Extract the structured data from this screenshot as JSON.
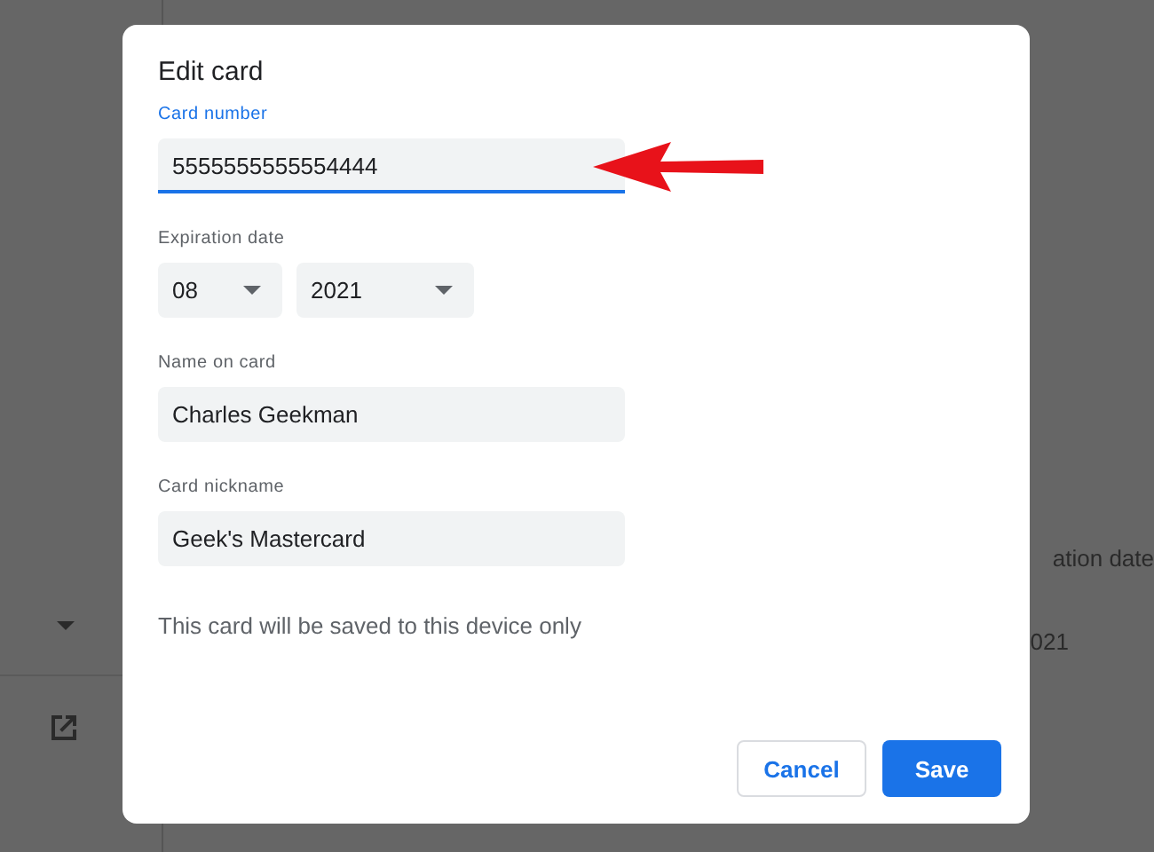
{
  "background": {
    "texts": [
      "ation date",
      "021"
    ]
  },
  "dialog": {
    "title": "Edit card",
    "fields": [
      {
        "kind": "text",
        "label": "Card number",
        "value": "5555555555554444",
        "focused": true
      },
      {
        "kind": "selects",
        "label": "Expiration date",
        "selects": [
          {
            "value": "08"
          },
          {
            "value": "2021"
          }
        ]
      },
      {
        "kind": "text",
        "label": "Name on card",
        "value": "Charles Geekman",
        "focused": false
      },
      {
        "kind": "text",
        "label": "Card nickname",
        "value": "Geek's Mastercard",
        "focused": false
      }
    ],
    "note": "This card will be saved to this device only",
    "buttons": [
      {
        "label": "Cancel",
        "kind": "secondary"
      },
      {
        "label": "Save",
        "kind": "primary"
      }
    ]
  }
}
